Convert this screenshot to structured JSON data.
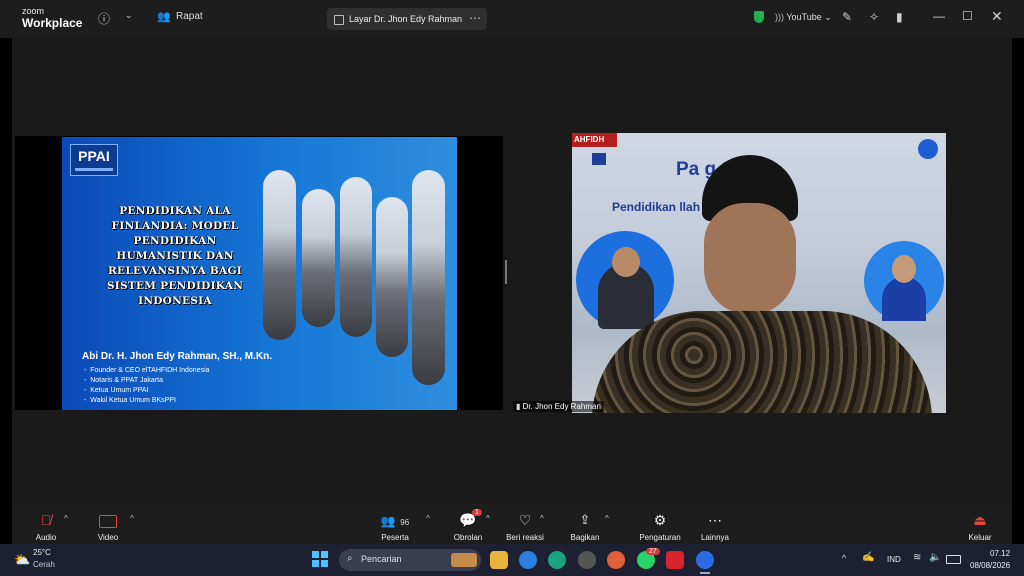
{
  "window": {
    "logo_line1": "zoom",
    "logo_line2": "Workplace",
    "rapat_label": "Rapat",
    "screen_tab_label": "Layar Dr. Jhon Edy Rahman",
    "youtube_label": "YouTube"
  },
  "slide": {
    "logo_text": "PPAI",
    "title_lines": [
      "PENDIDIKAN ALA",
      "FINLANDIA: MODEL",
      "PENDIDIKAN",
      "HUMANISTIK DAN",
      "RELEVANSINYA BAGI",
      "SISTEM PENDIDIKAN",
      "INDONESIA"
    ],
    "author": "Abi Dr. H. Jhon Edy Rahman, SH., M.Kn.",
    "roles": [
      "Founder & CEO elTAHFIDH Indonesia",
      "Notaris & PPAT Jakarta",
      "Ketua Umum PPAI",
      "Wakil Ketua Umum BKsPPI"
    ]
  },
  "speaker": {
    "poster_title": "Pa        g Series",
    "poster_subtitle": "Pendidikan            llah SAW dan",
    "poster_corner": "AHFIDH",
    "name_tag": "Dr. Jhon Edy Rahman"
  },
  "toolbar": {
    "audio": "Audio",
    "video": "Video",
    "participants": "Peserta",
    "participants_count": "96",
    "chat": "Obrolan",
    "chat_badge": "1",
    "react": "Beri reaksi",
    "share": "Bagikan",
    "settings": "Pengaturan",
    "more": "Lainnya",
    "leave": "Keluar",
    "leave_color": "#e5483b"
  },
  "taskbar": {
    "weather_temp": "25°C",
    "weather_desc": "Cerah",
    "search_placeholder": "Pencarian",
    "whatsapp_badge": "27",
    "lang": "IND",
    "time": "07.12",
    "date": "08/08/2026"
  }
}
